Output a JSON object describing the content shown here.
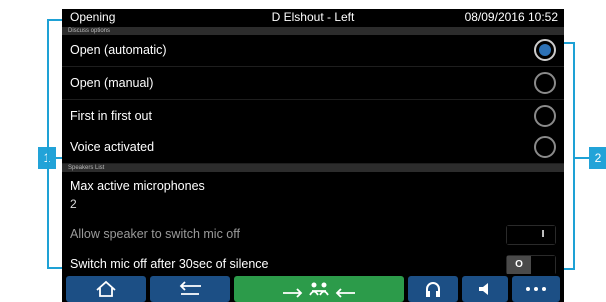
{
  "status": {
    "title": "Opening",
    "seat": "D Elshout - Left",
    "datetime": "08/09/2016 10:52"
  },
  "sections": {
    "discuss": "Discuss options",
    "speakers": "Speakers List"
  },
  "discuss_options": [
    {
      "label": "Open (automatic)",
      "selected": true
    },
    {
      "label": "Open (manual)",
      "selected": false
    },
    {
      "label": "First in first out",
      "selected": false
    },
    {
      "label": "Voice activated",
      "selected": false
    }
  ],
  "speakers": {
    "max_label": "Max active microphones",
    "max_value": "2",
    "allow_label": "Allow speaker to switch mic off",
    "allow_toggle": "I",
    "switch_label": "Switch mic off after 30sec of silence",
    "switch_toggle": "O"
  },
  "callouts": {
    "left": "1",
    "right": "2"
  },
  "colors": {
    "accent": "#1ea1d5",
    "radio_selected": "#2d72b6",
    "nav_blue": "#1c4f85",
    "nav_green": "#2c9b4a"
  },
  "nav": [
    "home-icon",
    "back-icon",
    "speaker-priority-icon",
    "headphones-icon",
    "speaker-icon",
    "more-icon"
  ]
}
